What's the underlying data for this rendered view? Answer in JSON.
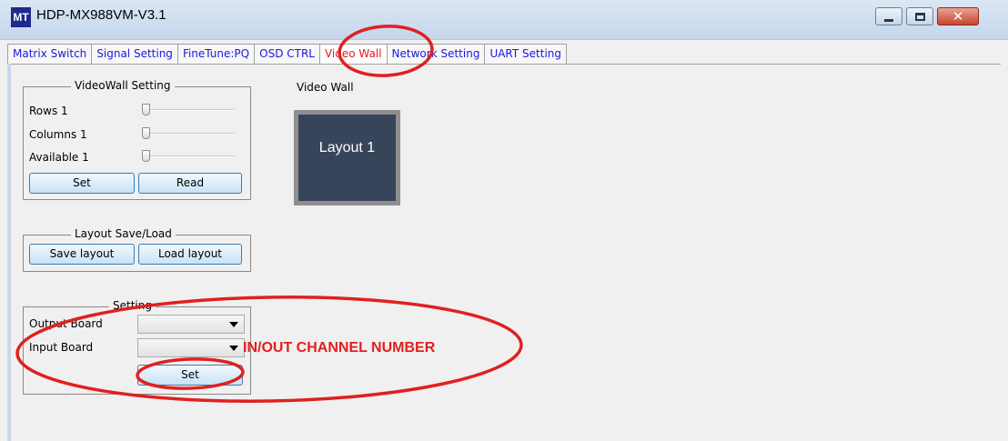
{
  "window": {
    "logo_text": "MT",
    "title": "HDP-MX988VM-V3.1"
  },
  "tabs": [
    {
      "label": "Matrix Switch"
    },
    {
      "label": "Signal Setting"
    },
    {
      "label": "FineTune:PQ"
    },
    {
      "label": "OSD CTRL"
    },
    {
      "label": "Video Wall",
      "active": true
    },
    {
      "label": "Network Setting"
    },
    {
      "label": "UART Setting"
    }
  ],
  "videowall_setting": {
    "title": "VideoWall Setting",
    "rows_label": "Rows 1",
    "columns_label": "Columns 1",
    "available_label": "Available 1",
    "set_button": "Set",
    "read_button": "Read"
  },
  "layout_save_load": {
    "title": "Layout Save/Load",
    "save_button": "Save layout",
    "load_button": "Load layout"
  },
  "setting": {
    "title": "Setting",
    "output_board_label": "Output Board",
    "output_board_value": "",
    "input_board_label": "Input Board",
    "input_board_value": "",
    "set_button": "Set"
  },
  "video_wall": {
    "title": "Video Wall",
    "layout_label": "Layout 1"
  },
  "annotations": {
    "text": "IN/OUT CHANNEL NUMBER",
    "color": "#e02020"
  }
}
